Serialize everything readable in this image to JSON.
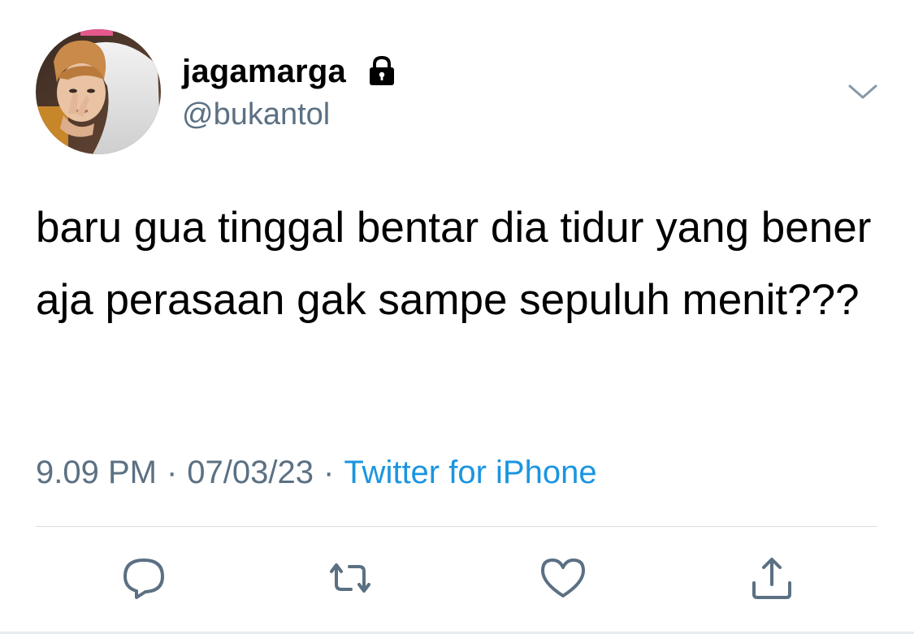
{
  "tweet": {
    "display_name": "jagamarga",
    "handle": "@bukantol",
    "protected_icon": "lock-icon",
    "menu_icon": "chevron-down-icon",
    "text": "baru gua tinggal bentar dia tidur yang bener aja perasaan gak sampe sepuluh menit???",
    "time": "9.09 PM",
    "date": "07/03/23",
    "separator": "·",
    "source": "Twitter for iPhone"
  },
  "actions": [
    {
      "name": "reply",
      "icon": "speech-bubble-icon"
    },
    {
      "name": "retweet",
      "icon": "retweet-arrows-icon"
    },
    {
      "name": "like",
      "icon": "heart-icon"
    },
    {
      "name": "share",
      "icon": "share-upload-icon"
    }
  ],
  "colors": {
    "text_primary": "#000000",
    "text_secondary": "#5b7083",
    "link": "#1b95e0",
    "divider": "#d9dde1",
    "icon": "#5b7083"
  }
}
